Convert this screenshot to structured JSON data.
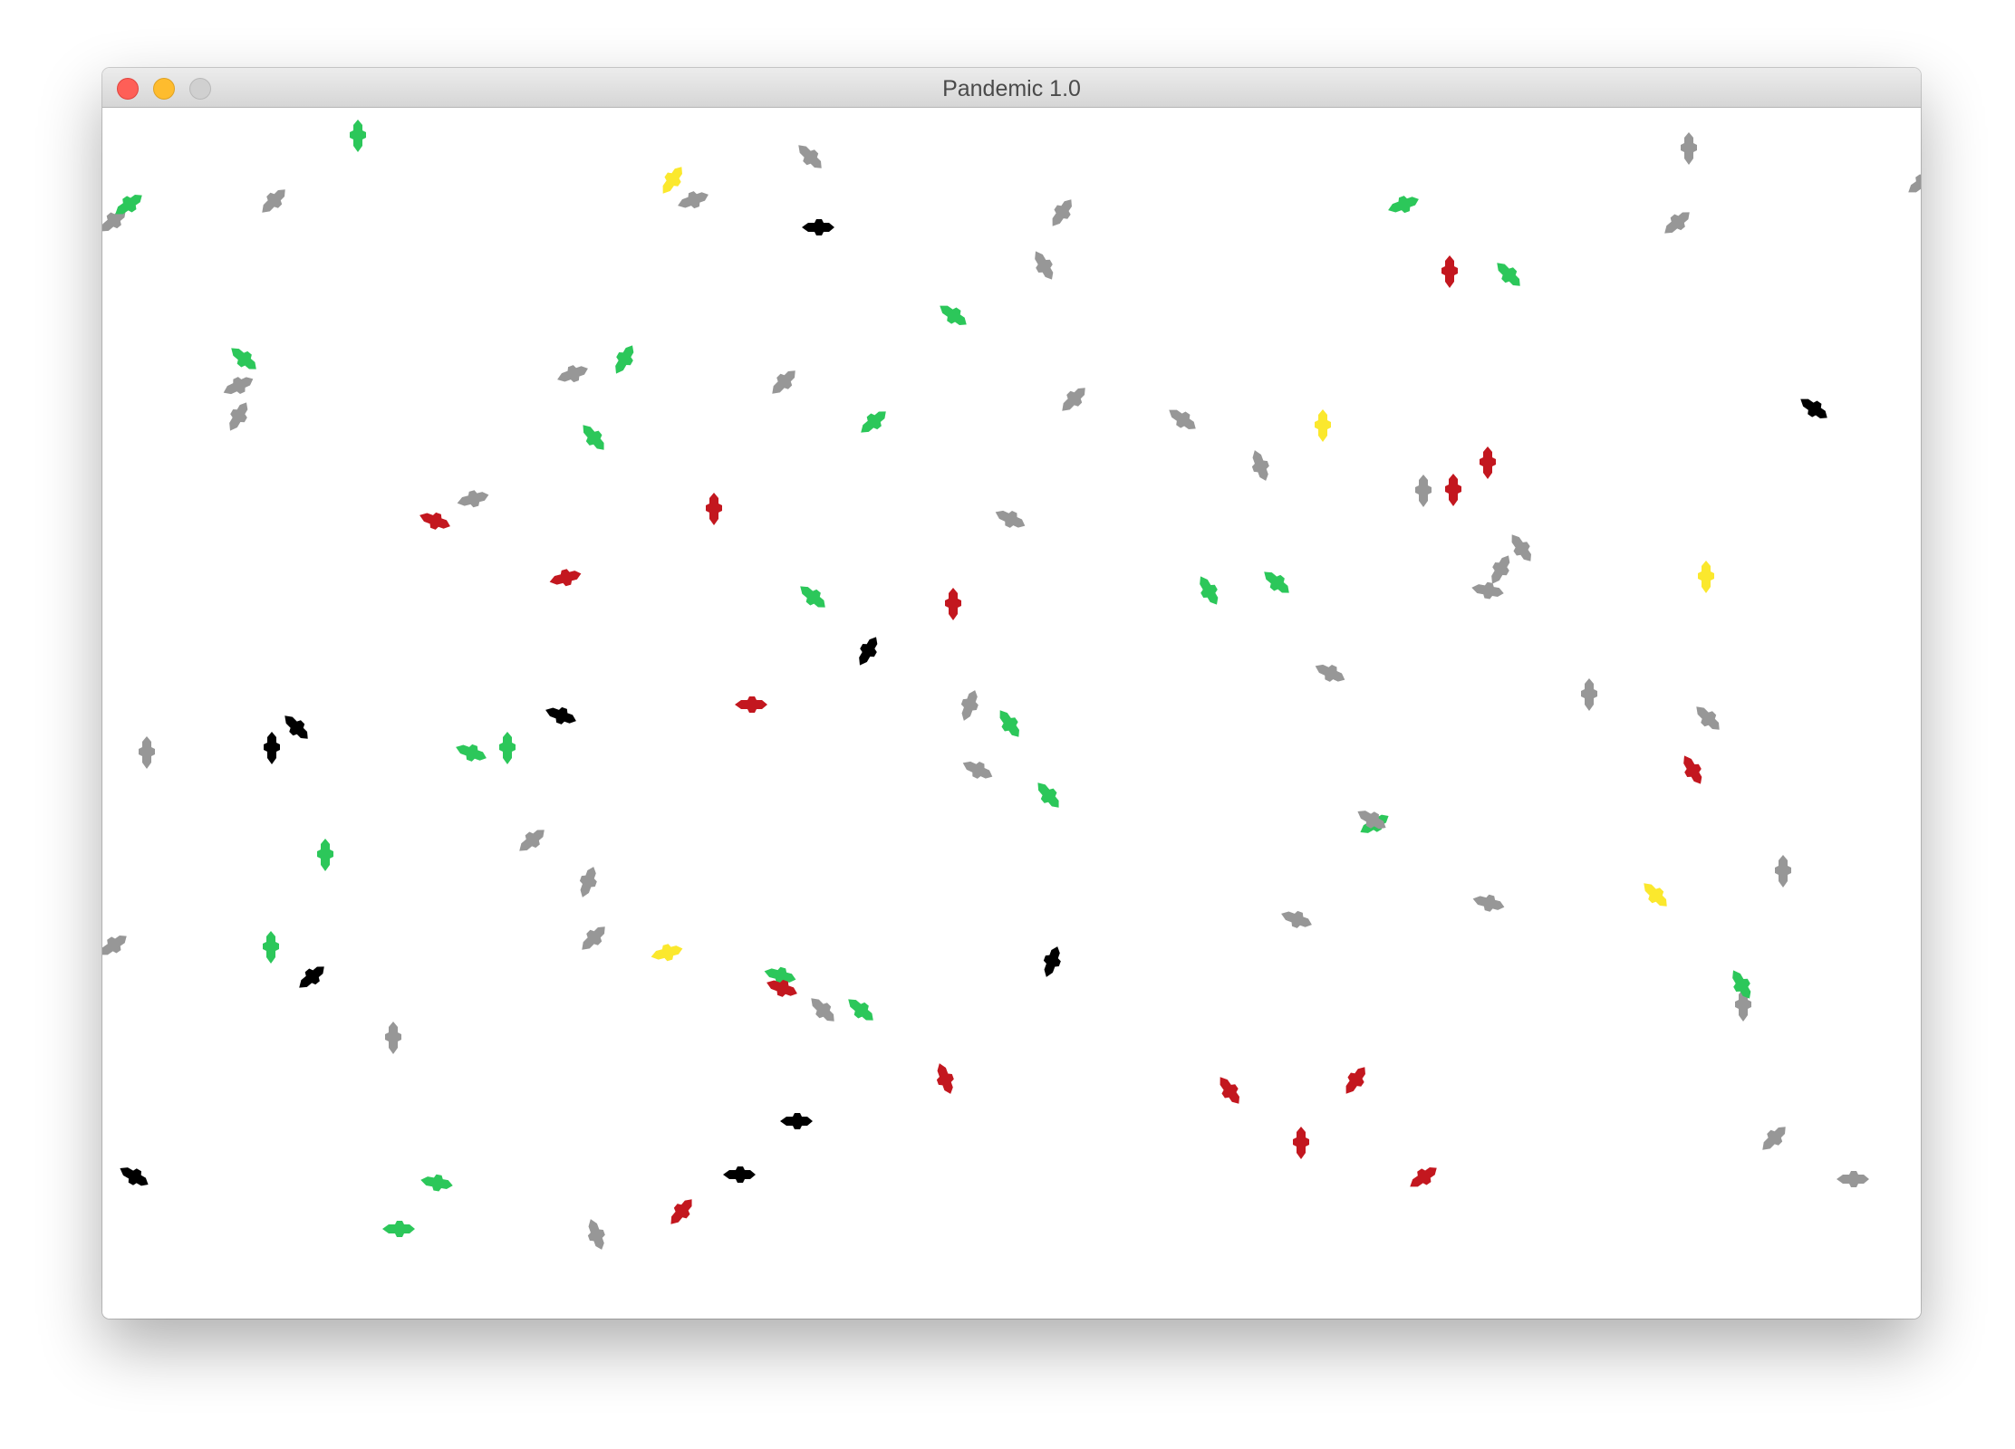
{
  "window": {
    "title": "Pandemic 1.0",
    "controls": {
      "close_icon": "close-icon",
      "minimize_icon": "minimize-icon",
      "zoom_icon": "zoom-icon"
    }
  },
  "legend_colors": {
    "grey": "#979797",
    "green": "#2cc75a",
    "red": "#c3171f",
    "black": "#000000",
    "yellow": "#fbe82d"
  },
  "simulation": {
    "agent_counts": {
      "grey": 53,
      "green": 24,
      "red": 19,
      "black": 12,
      "yellow": 6
    }
  }
}
